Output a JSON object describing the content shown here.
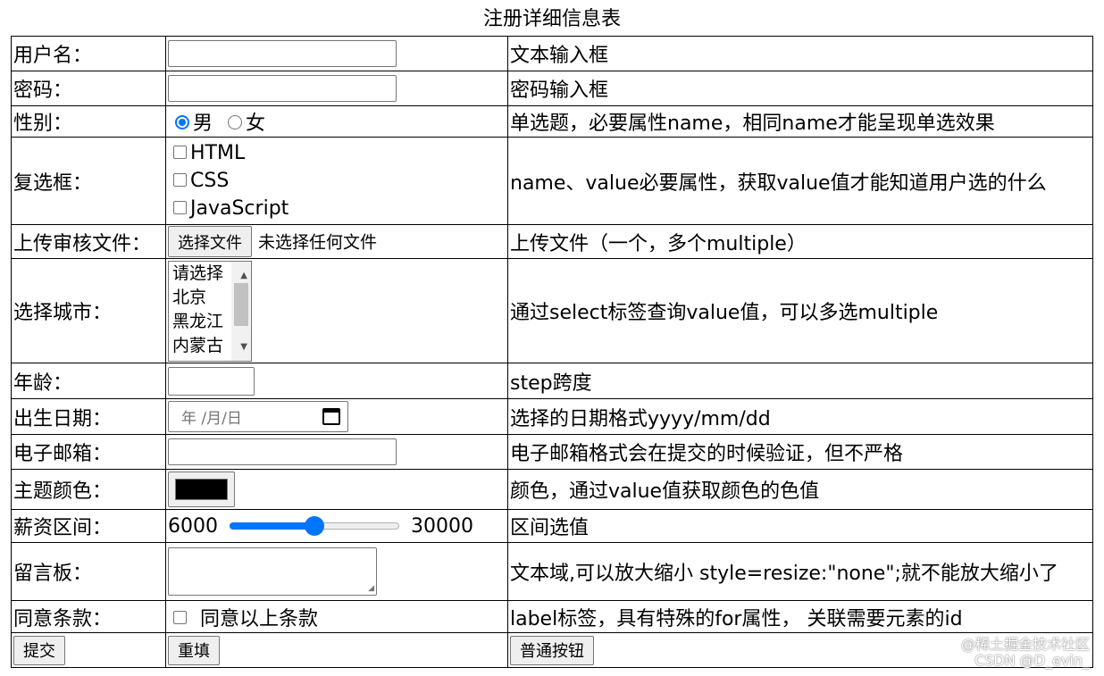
{
  "caption": "注册详细信息表",
  "rows": {
    "username": {
      "label": "用户名：",
      "value": "",
      "desc": "文本输入框"
    },
    "password": {
      "label": "密码：",
      "value": "",
      "desc": "密码输入框"
    },
    "gender": {
      "label": "性别：",
      "options": [
        "男",
        "女"
      ],
      "selected": "男",
      "desc": "单选题，必要属性name，相同name才能呈现单选效果"
    },
    "checkbox": {
      "label": "复选框：",
      "options": [
        "HTML",
        "CSS",
        "JavaScript"
      ],
      "desc": "name、value必要属性，获取value值才能知道用户选的什么"
    },
    "upload": {
      "label": "上传审核文件：",
      "button": "选择文件",
      "status": "未选择任何文件",
      "desc": "上传文件（一个，多个multiple）"
    },
    "city": {
      "label": "选择城市：",
      "options": [
        "请选择",
        "北京",
        "黑龙江",
        "内蒙古"
      ],
      "desc": "通过select标签查询value值，可以多选multiple"
    },
    "age": {
      "label": "年龄：",
      "value": "",
      "desc": "step跨度"
    },
    "birthday": {
      "label": "出生日期：",
      "placeholder": "年 /月/日",
      "desc": "选择的日期格式yyyy/mm/dd"
    },
    "email": {
      "label": "电子邮箱：",
      "value": "",
      "desc": "电子邮箱格式会在提交的时候验证，但不严格"
    },
    "theme": {
      "label": "主题颜色：",
      "color": "#000000",
      "desc": "颜色，通过value值获取颜色的色值"
    },
    "salary": {
      "label": "薪资区间：",
      "min": "6000",
      "max": "30000",
      "fraction": 0.5,
      "desc": "区间选值"
    },
    "message": {
      "label": "留言板：",
      "value": "",
      "desc": "文本域,可以放大缩小 style=resize:\"none\";就不能放大缩小了"
    },
    "agree": {
      "label": "同意条款：",
      "text": "同意以上条款",
      "desc": "label标签，具有特殊的for属性， 关联需要元素的id"
    }
  },
  "buttons": {
    "submit": "提交",
    "reset": "重填",
    "normal": "普通按钮"
  },
  "watermark": {
    "line1": "@稀土掘金技术社区",
    "line2": "CSDN @D_evin_"
  }
}
